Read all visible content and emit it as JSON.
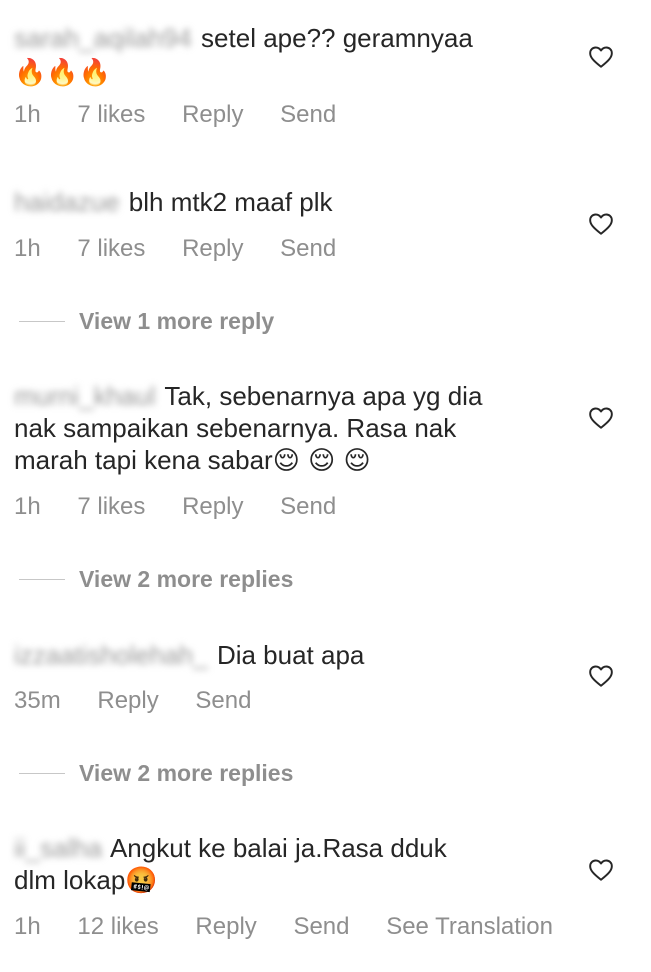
{
  "comments": [
    {
      "username": "sarah_aqilah94",
      "text": "setel ape?? geramnyaa",
      "emoji_line": "🔥🔥🔥",
      "time": "1h",
      "likes": "7 likes",
      "reply_label": "Reply",
      "send_label": "Send"
    },
    {
      "username": "haidazue",
      "text": "blh mtk2 maaf plk",
      "time": "1h",
      "likes": "7 likes",
      "reply_label": "Reply",
      "send_label": "Send"
    },
    {
      "username": "murni_khaul",
      "text_line1": "Tak, sebenarnya apa yg dia",
      "text_line2": "nak sampaikan sebenarnya. Rasa nak",
      "text_line3": "marah tapi kena sabar",
      "emoji_tail": "😌 😌 😌",
      "time": "1h",
      "likes": "7 likes",
      "reply_label": "Reply",
      "send_label": "Send"
    },
    {
      "username": "izzaatisholehah_",
      "text": "Dia buat apa",
      "time": "35m",
      "reply_label": "Reply",
      "send_label": "Send"
    },
    {
      "username": "ii_salha",
      "text_line1": "Angkut ke balai ja.Rasa dduk",
      "text_line2": "dlm lokap",
      "emoji_tail": "🤬",
      "time": "1h",
      "likes": "12 likes",
      "reply_label": "Reply",
      "send_label": "Send",
      "translate_label": "See Translation"
    }
  ],
  "view_replies": [
    "View 1 more reply",
    "View 2 more replies",
    "View 2 more replies"
  ],
  "icons": {
    "like": "heart-outline-icon"
  },
  "colors": {
    "text": "#262626",
    "meta": "#8e8e8e",
    "divider": "#c7c7c7"
  }
}
